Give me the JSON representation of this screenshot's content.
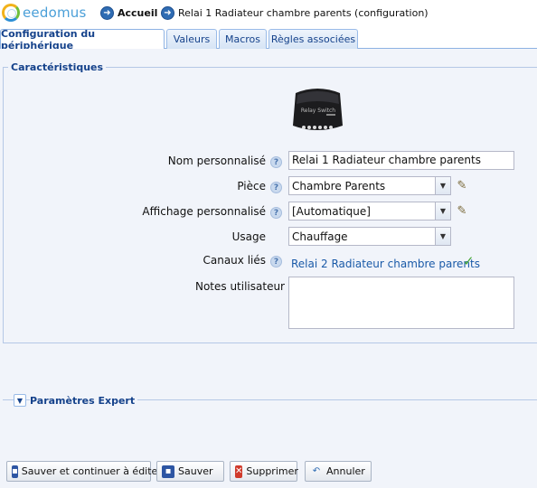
{
  "app": {
    "logo_text": "eedomus"
  },
  "breadcrumb": {
    "home": "Accueil",
    "current": "Relai 1 Radiateur chambre parents (configuration)"
  },
  "tabs": [
    {
      "label": "Configuration du périphérique",
      "active": true
    },
    {
      "label": "Valeurs",
      "active": false
    },
    {
      "label": "Macros",
      "active": false
    },
    {
      "label": "Règles associées",
      "active": false
    }
  ],
  "section": {
    "title": "Caractéristiques"
  },
  "device_image": {
    "text": "Relay Switch"
  },
  "form": {
    "name_label": "Nom personnalisé",
    "name_value": "Relai 1 Radiateur chambre parents",
    "room_label": "Pièce",
    "room_value": "Chambre Parents",
    "display_label": "Affichage personnalisé",
    "display_value": "[Automatique]",
    "usage_label": "Usage",
    "usage_value": "Chauffage",
    "channels_label": "Canaux liés",
    "channels_value": "Relai 2 Radiateur chambre parents",
    "notes_label": "Notes utilisateur",
    "notes_value": ""
  },
  "expert": {
    "title": "Paramètres Expert"
  },
  "buttons": {
    "save_continue": "Sauver et continuer à éditer",
    "save": "Sauver",
    "delete": "Supprimer",
    "cancel": "Annuler"
  },
  "icons": {
    "help": "help-icon",
    "edit": "pencil-icon",
    "check": "check-icon"
  }
}
